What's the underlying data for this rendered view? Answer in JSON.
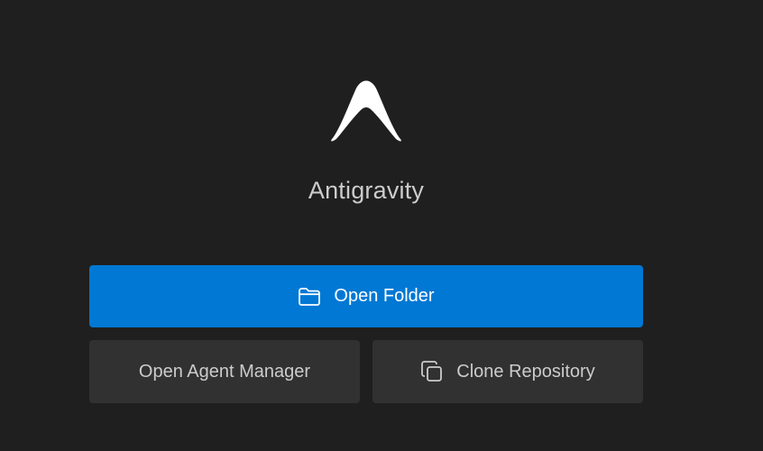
{
  "app": {
    "title": "Antigravity"
  },
  "actions": {
    "open_folder": {
      "label": "Open Folder",
      "icon": "folder-icon"
    },
    "open_agent_manager": {
      "label": "Open Agent Manager"
    },
    "clone_repository": {
      "label": "Clone Repository",
      "icon": "copy-icon"
    }
  },
  "colors": {
    "background": "#1f1f1f",
    "primary_button": "#0078d4",
    "secondary_button": "#313131",
    "text": "#cccccc"
  }
}
